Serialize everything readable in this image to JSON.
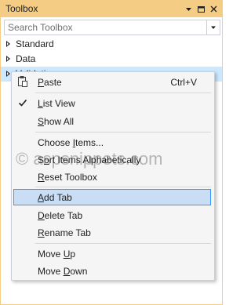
{
  "window": {
    "title": "Toolbox"
  },
  "titlebar_buttons": [
    {
      "name": "pin-down-icon",
      "glyph": "▾"
    },
    {
      "name": "auto-hide-icon",
      "glyph": "▣"
    },
    {
      "name": "close-icon",
      "glyph": "✕"
    }
  ],
  "search": {
    "placeholder": "Search Toolbox",
    "value": ""
  },
  "tree": [
    {
      "label": "Standard",
      "selected": false
    },
    {
      "label": "Data",
      "selected": false
    },
    {
      "label": "Validation",
      "selected": true
    }
  ],
  "context_menu": {
    "items": [
      {
        "id": "paste",
        "label": "Paste",
        "accel": "P",
        "shortcut": "Ctrl+V",
        "icon": "clipboard-icon"
      },
      {
        "id": "list-view",
        "label": "List View",
        "accel": "L",
        "checked": true
      },
      {
        "id": "show-all",
        "label": "Show All",
        "accel": "S"
      },
      {
        "id": "choose-items",
        "label": "Choose Items...",
        "accel": "I"
      },
      {
        "id": "sort-items",
        "label": "Sort Items Alphabetically",
        "accel": "o"
      },
      {
        "id": "reset-toolbox",
        "label": "Reset Toolbox",
        "accel": "R"
      },
      {
        "id": "add-tab",
        "label": "Add Tab",
        "accel": "A",
        "highlighted": true
      },
      {
        "id": "delete-tab",
        "label": "Delete Tab",
        "accel": "D"
      },
      {
        "id": "rename-tab",
        "label": "Rename Tab",
        "accel": "R"
      },
      {
        "id": "move-up",
        "label": "Move Up",
        "accel": "U"
      },
      {
        "id": "move-down",
        "label": "Move Down",
        "accel": "D"
      }
    ]
  },
  "watermark": "© aspsnippets.com"
}
